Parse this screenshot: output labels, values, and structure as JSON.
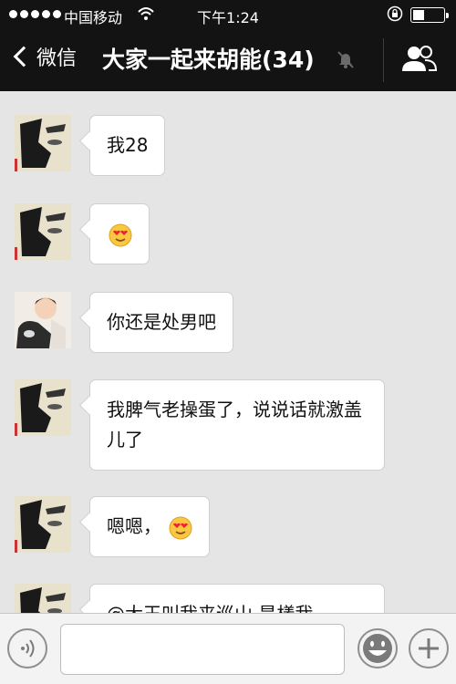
{
  "status_bar": {
    "carrier": "中国移动",
    "time": "下午1:24",
    "icons": [
      "signal-dots-icon",
      "wifi-icon",
      "rotation-lock-icon",
      "battery-icon"
    ]
  },
  "nav": {
    "back_label": "微信",
    "title": "大家一起来胡能(34)",
    "icons": [
      "chevron-left-icon",
      "mute-bell-icon",
      "contacts-icon"
    ]
  },
  "messages": [
    {
      "sender": "user-a",
      "text": "我28"
    },
    {
      "sender": "user-a",
      "text": "",
      "emoji": "heart-eyes-emoji"
    },
    {
      "sender": "user-b",
      "text": "你还是处男吧"
    },
    {
      "sender": "user-a",
      "text": "我脾气老操蛋了，说说话就激盖儿了"
    },
    {
      "sender": "user-a",
      "text": "嗯嗯，",
      "emoji": "heart-eyes-emoji"
    },
    {
      "sender": "user-a",
      "text": "@大王叫我来巡山 是樣我"
    }
  ],
  "input_bar": {
    "placeholder": "",
    "icons": [
      "voice-icon",
      "emoji-icon",
      "plus-icon"
    ]
  },
  "colors": {
    "bar": "#131313",
    "chat_bg": "#e5e5e5",
    "bubble": "#ffffff",
    "input_bar": "#f3f3f3"
  }
}
